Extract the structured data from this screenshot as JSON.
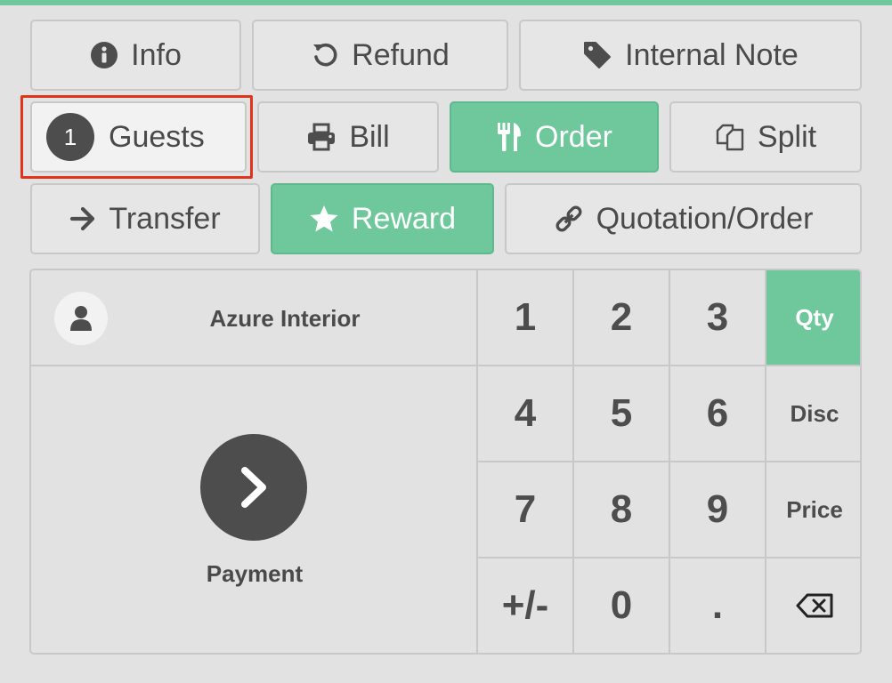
{
  "actions": {
    "info": "Info",
    "refund": "Refund",
    "internal_note": "Internal Note",
    "guests_count": "1",
    "guests": "Guests",
    "bill": "Bill",
    "order": "Order",
    "split": "Split",
    "transfer": "Transfer",
    "reward": "Reward",
    "quotation": "Quotation/Order"
  },
  "customer": {
    "name": "Azure Interior"
  },
  "payment": {
    "label": "Payment"
  },
  "numpad": {
    "k1": "1",
    "k2": "2",
    "k3": "3",
    "k4": "4",
    "k5": "5",
    "k6": "6",
    "k7": "7",
    "k8": "8",
    "k9": "9",
    "plusminus": "+/-",
    "k0": "0",
    "dot": "."
  },
  "modes": {
    "qty": "Qty",
    "disc": "Disc",
    "price": "Price",
    "active": "qty"
  },
  "colors": {
    "accent": "#6ec89b",
    "dark": "#4d4d4d",
    "highlight": "#e0341c"
  }
}
